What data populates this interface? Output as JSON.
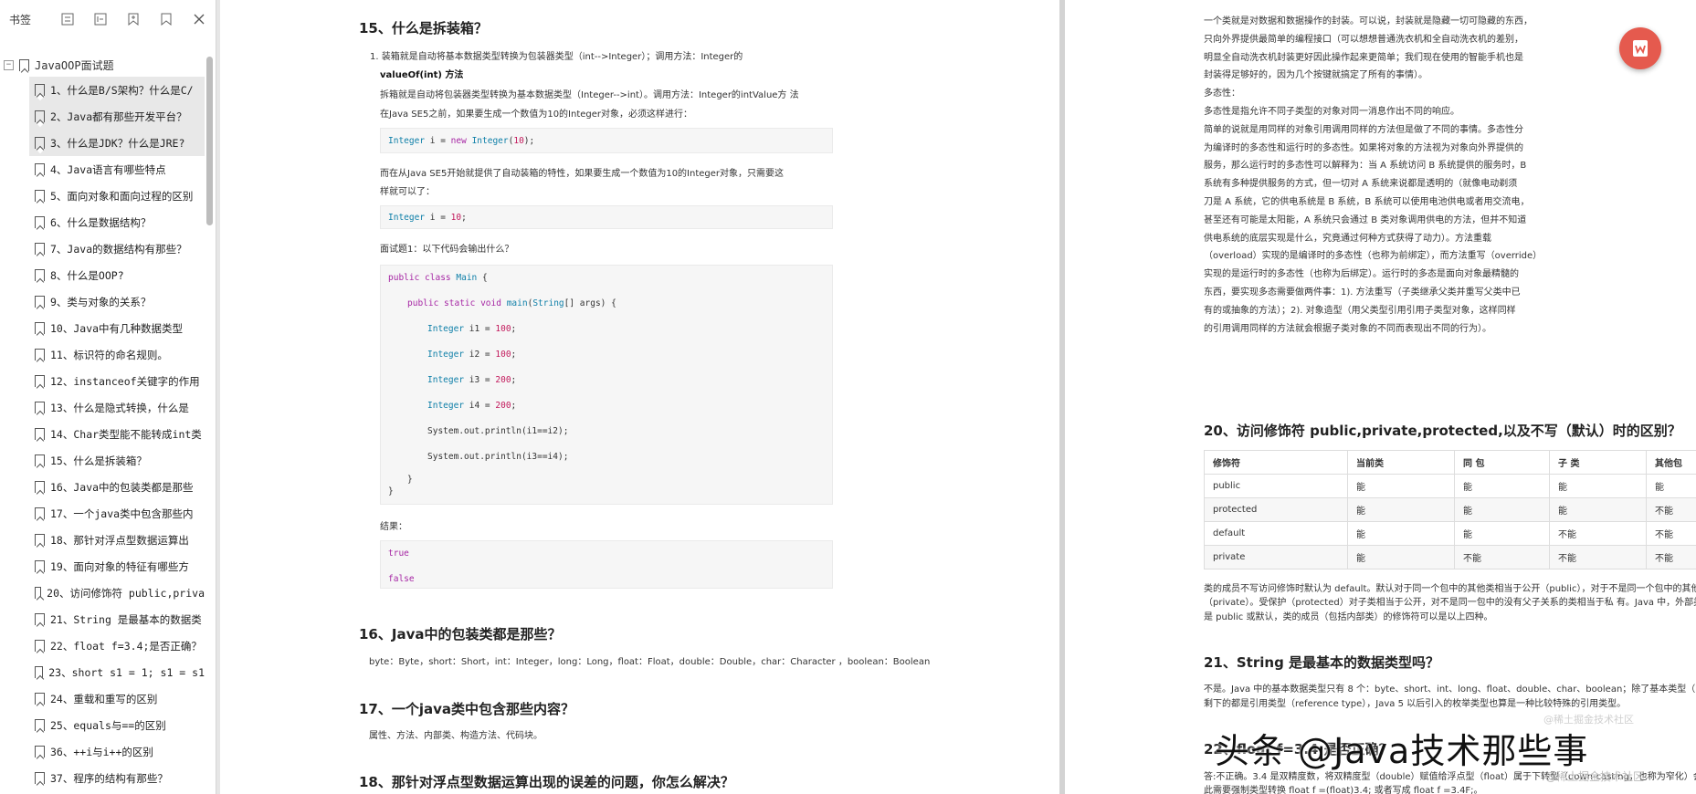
{
  "sidebar": {
    "title": "书签",
    "root": "JavaOOP面试题",
    "items": [
      "1、什么是B/S架构？什么是C/",
      "2、Java都有那些开发平台？",
      "3、什么是JDK？什么是JRE?",
      "4、Java语言有哪些特点",
      "5、面向对象和面向过程的区别",
      "6、什么是数据结构？",
      "7、Java的数据结构有那些？",
      "8、什么是OOP?",
      "9、类与对象的关系？",
      "10、Java中有几种数据类型",
      "11、标识符的命名规则。",
      "12、instanceof关键字的作用",
      "13、什么是隐式转换，什么是",
      "14、Char类型能不能转成int类",
      "15、什么是拆装箱？",
      "16、Java中的包装类都是那些",
      "17、一个java类中包含那些内",
      "18、那针对浮点型数据运算出",
      "19、面向对象的特征有哪些方",
      "20、访问修饰符 public,priva",
      "21、String 是最基本的数据类",
      "22、float f=3.4;是否正确？",
      "23、short s1 = 1; s1 = s1",
      "24、重载和重写的区别",
      "25、equals与==的区别",
      "36、++i与i++的区别",
      "37、程序的结构有那些？"
    ]
  },
  "page1": {
    "h15": "15、什么是拆装箱？",
    "p1a": "1. 装箱就是自动将基本数据类型转换为包装器类型（int-->Integer）；调用方法：Integer的",
    "p1b": "valueOf(int) 方法",
    "p1c": "拆箱就是自动将包装器类型转换为基本数据类型（Integer-->int）。调用方法：Integer的intValue方 法",
    "p1d": "在Java SE5之前，如果要生成一个数值为10的Integer对象，必须这样进行：",
    "code1": [
      "Integer",
      " i = ",
      "new",
      " ",
      "Integer",
      "(",
      "10",
      ");"
    ],
    "p2a": "而在从Java SE5开始就提供了自动装箱的特性，如果要生成一个数值为10的Integer对象，只需要这",
    "p2b": "样就可以了：",
    "code2": [
      "Integer",
      " i = ",
      "10",
      ";"
    ],
    "p3": "面试题1：以下代码会输出什么？",
    "code3": {
      "l1": [
        "public class",
        " ",
        "Main",
        " {"
      ],
      "l2": [
        "public static void",
        " ",
        "main",
        "(",
        "String",
        "[] args) {"
      ],
      "v1": [
        "Integer",
        " i1 = ",
        "100",
        ";"
      ],
      "v2": [
        "Integer",
        " i2 = ",
        "100",
        ";"
      ],
      "v3": [
        "Integer",
        " i3 = ",
        "200",
        ";"
      ],
      "v4": [
        "Integer",
        " i4 = ",
        "200",
        ";"
      ],
      "p1": "System.out.println(i1==i2);",
      "p2": "System.out.println(i3==i4);",
      "c1": "}",
      "c2": "}"
    },
    "result_label": "结果：",
    "res1": "true",
    "res2": "false",
    "h16": "16、Java中的包装类都是那些？",
    "p16": "byte：Byte，short：Short，int：Integer，long：Long，float：Float，double：Double，char：Character ，boolean：Boolean",
    "h17": "17、一个java类中包含那些内容？",
    "p17": "属性、方法、内部类、构造方法、代码块。",
    "h18": "18、那针对浮点型数据运算出现的误差的问题，你怎么解决？"
  },
  "page2": {
    "lines_top": [
      "一个类就是对数据和数据操作的封装。可以说，封装就是隐藏一切可隐藏的东西，",
      "只向外界提供最简单的编程接口（可以想想普通洗衣机和全自动洗衣机的差别，",
      "明显全自动洗衣机封装更好因此操作起来更简单；我们现在使用的智能手机也是",
      "封装得足够好的，因为几个按键就搞定了所有的事情）。",
      "多态性：",
      "多态性是指允许不同子类型的对象对同一消息作出不同的响应。",
      "简单的说就是用同样的对象引用调用同样的方法但是做了不同的事情。多态性分",
      "为编译时的多态性和运行时的多态性。如果将对象的方法视为对象向外界提供的",
      "服务，那么运行时的多态性可以解释为：当 A 系统访问 B 系统提供的服务时，B",
      "系统有多种提供服务的方式，但一切对 A 系统来说都是透明的（就像电动剃须",
      "刀是 A 系统，它的供电系统是 B 系统，B 系统可以使用电池供电或者用交流电，",
      "甚至还有可能是太阳能，A 系统只会通过 B 类对象调用供电的方法，但并不知道",
      "供电系统的底层实现是什么，究竟通过何种方式获得了动力）。方法重载",
      "（overload）实现的是编译时的多态性（也称为前绑定），而方法重写（override）",
      "实现的是运行时的多态性（也称为后绑定）。运行时的多态是面向对象最精髓的",
      "东西，要实现多态需要做两件事：1). 方法重写（子类继承父类并重写父类中已",
      "有的或抽象的方法）；2). 对象造型（用父类型引用引用子类型对象，这样同样",
      "的引用调用同样的方法就会根据子类对象的不同而表现出不同的行为）。"
    ],
    "h20": "20、访问修饰符 public,private,protected,以及不写（默认）时的区别？",
    "table": {
      "headers": [
        "修饰符",
        "当前类",
        "同 包",
        "子 类",
        "其他包"
      ],
      "rows": [
        [
          "public",
          "能",
          "能",
          "能",
          "能"
        ],
        [
          "protected",
          "能",
          "能",
          "能",
          "不能"
        ],
        [
          "default",
          "能",
          "能",
          "不能",
          "不能"
        ],
        [
          "private",
          "能",
          "不能",
          "不能",
          "不能"
        ]
      ]
    },
    "after_table": [
      "类的成员不写访问修饰时默认为 default。默认对于同一个包中的其他类相当于公开（public），对于不是同一个包中的其他类",
      "（private）。受保护（protected）对子类相当于公开，对不是同一包中的没有父子关系的类相当于私 有。Java 中，外部类",
      "是 public 或默认，类的成员（包括内部类）的修饰符可以是以上四种。"
    ],
    "h21": "21、String 是最基本的数据类型吗？",
    "p21": [
      "不是。Java 中的基本数据类型只有 8 个：byte、short、int、long、float、double、char、boolean；除了基本类型（pri",
      "剩下的都是引用类型（reference type），Java 5 以后引入的枚举类型也算是一种比较特殊的引用类型。"
    ],
    "h22": "22、float f=3.4;是否正确？",
    "p22": [
      "答:不正确。3.4 是双精度数，将双精度型（double）赋值给浮点型（float）属于下转型（down-casting，也称为窄化）会",
      "此需要强制类型转换 float f =(float)3.4; 或者写成 float f =3.4F;。"
    ]
  },
  "watermark": "头条 @Java技术那些事",
  "watermark_small": "@稀土掘金技术社区",
  "colors": {
    "accent": "#e55a4e",
    "keyword": "#a626a4",
    "type": "#0e7fa8",
    "number": "#c2185b"
  }
}
